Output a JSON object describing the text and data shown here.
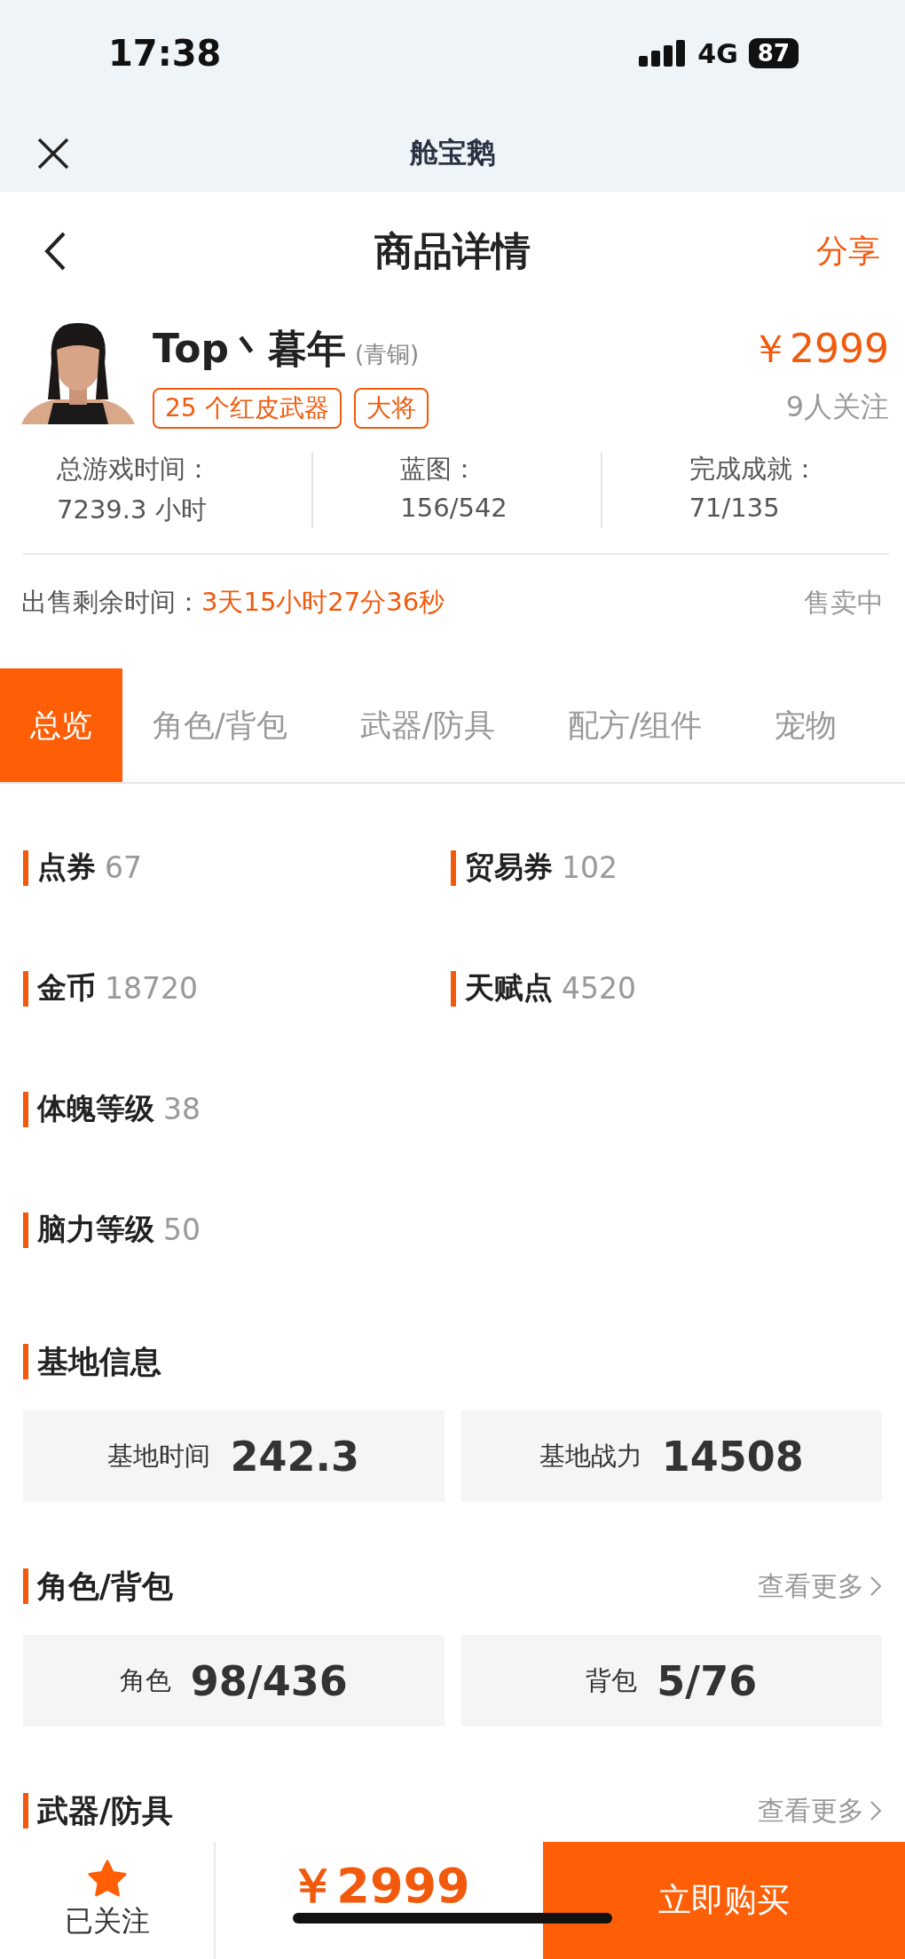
{
  "status_bar": {
    "time": "17:38",
    "network": "4G",
    "battery": "87"
  },
  "nav": {
    "title": "舱宝鹅"
  },
  "header": {
    "title": "商品详情",
    "action": "分享"
  },
  "seller": {
    "name": "Top丶暮年",
    "rank": "(青铜)",
    "tags": [
      "25 个红皮武器",
      "大将"
    ],
    "price": "￥2999",
    "followers": "9人关注"
  },
  "stats": [
    {
      "label": "总游戏时间：",
      "value": "7239.3 小时"
    },
    {
      "label": "蓝图：",
      "value": "156/542"
    },
    {
      "label": "完成成就：",
      "value": "71/135"
    }
  ],
  "sale": {
    "label": "出售剩余时间：",
    "countdown": "3天15小时27分36秒",
    "status": "售卖中"
  },
  "tabs": [
    {
      "label": "总览",
      "selected": true
    },
    {
      "label": "角色/背包",
      "selected": false
    },
    {
      "label": "武器/防具",
      "selected": false
    },
    {
      "label": "配方/组件",
      "selected": false
    },
    {
      "label": "宠物",
      "selected": false
    }
  ],
  "attribute_rows": [
    {
      "items": [
        {
          "label": "点券",
          "value": "67"
        },
        {
          "label": "贸易券",
          "value": "102"
        }
      ]
    },
    {
      "items": [
        {
          "label": "金币",
          "value": "18720"
        },
        {
          "label": "天赋点",
          "value": "4520"
        }
      ]
    },
    {
      "items": [
        {
          "label": "体魄等级",
          "value": "38"
        }
      ]
    },
    {
      "items": [
        {
          "label": "脑力等级",
          "value": "50"
        }
      ]
    }
  ],
  "sections": [
    {
      "title": "基地信息",
      "cards": [
        {
          "label": "基地时间",
          "value": "242.3"
        },
        {
          "label": "基地战力",
          "value": "14508"
        }
      ]
    },
    {
      "title": "角色/背包",
      "more": "查看更多",
      "cards": [
        {
          "label": "角色",
          "value": "98/436"
        },
        {
          "label": "背包",
          "value": "5/76"
        }
      ]
    },
    {
      "title": "武器/防具",
      "more": "查看更多"
    }
  ],
  "bottom_bar": {
    "follow_label": "已关注",
    "followed": true,
    "price": "￥2999",
    "buy": "立即购买"
  }
}
